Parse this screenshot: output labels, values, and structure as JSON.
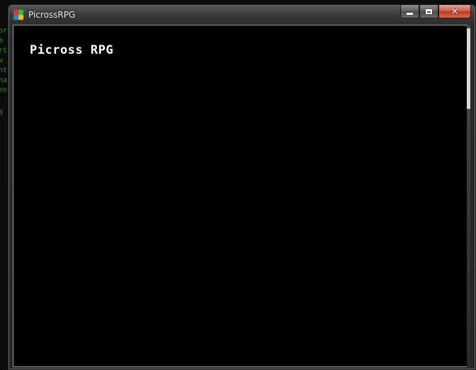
{
  "window": {
    "title": "PicrossRPG"
  },
  "game": {
    "title": "Picross RPG"
  },
  "background_terminal": {
    "lines": [
      "or",
      "m",
      "rt",
      "w",
      "nt",
      "na",
      "en",
      "",
      "3"
    ]
  },
  "colors": {
    "client_background": "#000000",
    "title_text": "#ffffff",
    "terminal_text": "#2e8b2e",
    "close_button": "#c75a45"
  },
  "icons": {
    "app": "picross-app-icon",
    "minimize": "minimize-icon",
    "maximize": "maximize-icon",
    "close": "close-icon"
  }
}
